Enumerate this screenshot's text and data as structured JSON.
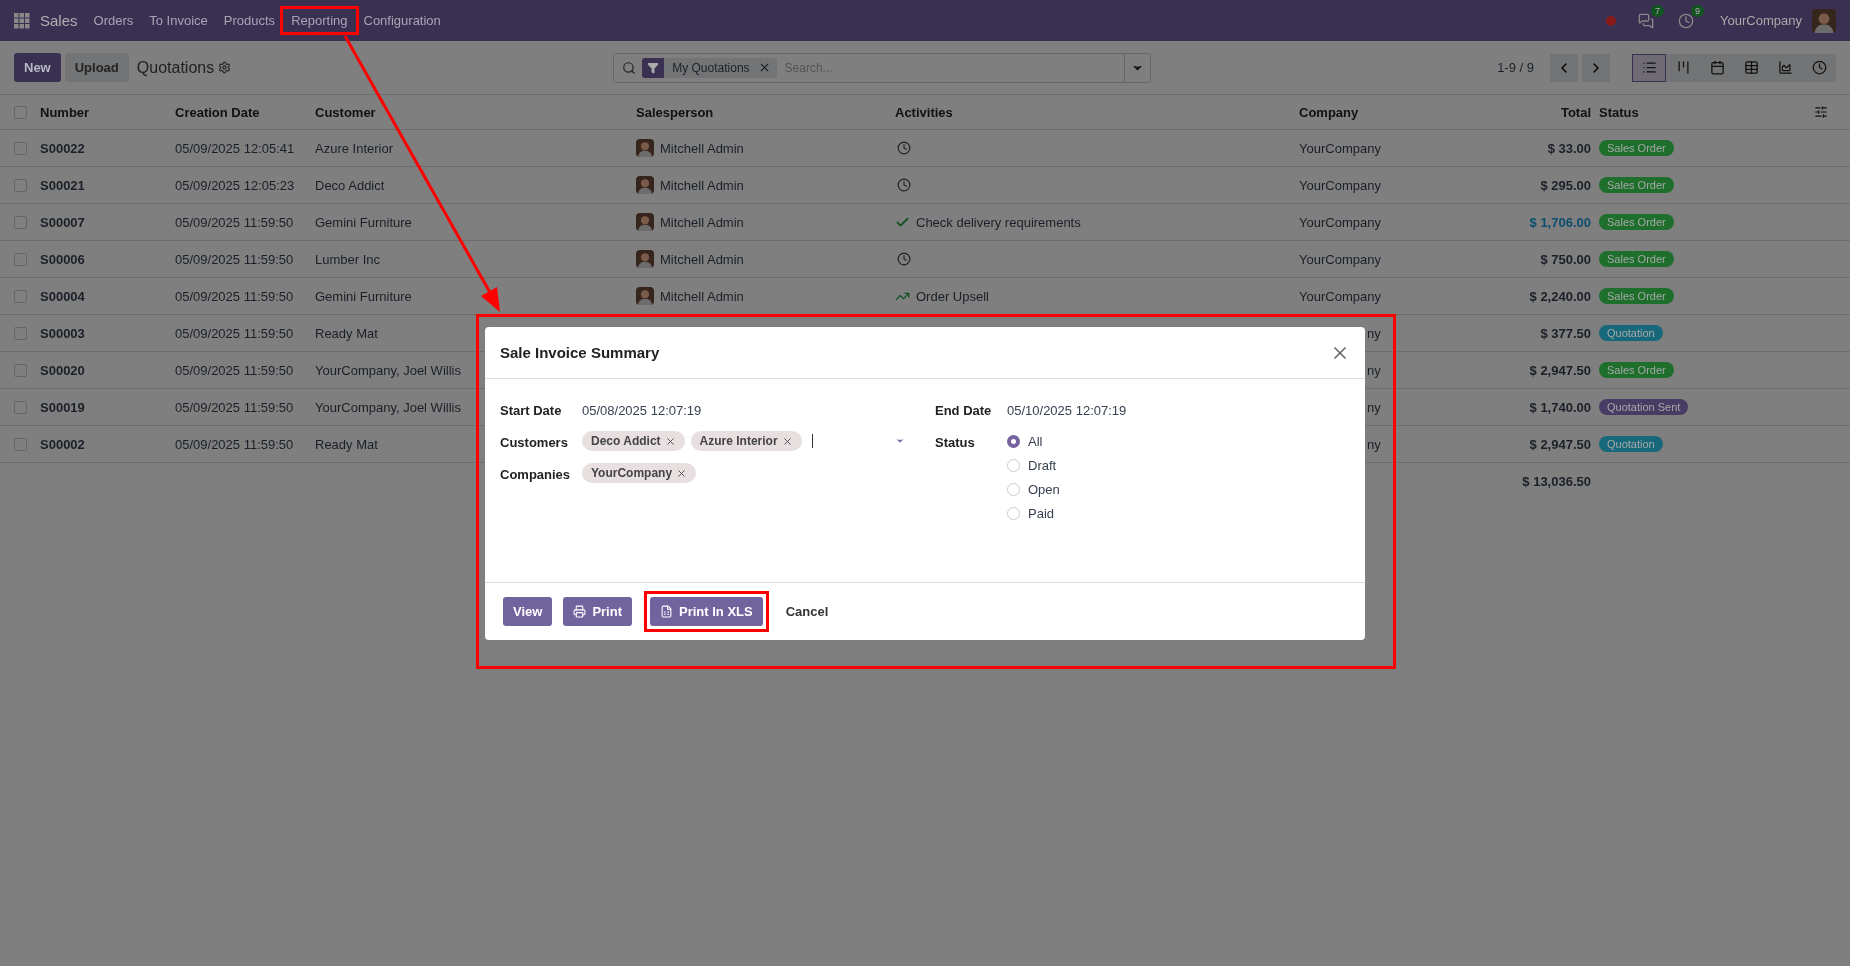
{
  "topbar": {
    "app": "Sales",
    "menu": [
      {
        "label": "Orders",
        "annotated": false
      },
      {
        "label": "To Invoice",
        "annotated": false
      },
      {
        "label": "Products",
        "annotated": false
      },
      {
        "label": "Reporting",
        "annotated": true
      },
      {
        "label": "Configuration",
        "annotated": false
      }
    ],
    "messages_badge": "7",
    "activities_badge": "9",
    "company": "YourCompany"
  },
  "control_panel": {
    "new_button": "New",
    "upload_button": "Upload",
    "title": "Quotations",
    "search": {
      "facet": "My Quotations",
      "placeholder": "Search..."
    },
    "pager": "1-9 / 9",
    "views": [
      {
        "kind": "list",
        "selected": true
      },
      {
        "kind": "kanban",
        "selected": false
      },
      {
        "kind": "calendar",
        "selected": false
      },
      {
        "kind": "pivot",
        "selected": false
      },
      {
        "kind": "graph",
        "selected": false
      },
      {
        "kind": "activity",
        "selected": false
      }
    ]
  },
  "table": {
    "select_all_checked": false,
    "columns": [
      "Number",
      "Creation Date",
      "Customer",
      "Salesperson",
      "Activities",
      "Company",
      "Total",
      "Status"
    ],
    "rows": [
      {
        "checked": false,
        "number": "S00022",
        "date": "05/09/2025 12:05:41",
        "customer": "Azure Interior",
        "salesperson": "Mitchell Admin",
        "activity": {
          "kind": "clock"
        },
        "company": "YourCompany",
        "company_clipped": false,
        "total": "$ 33.00",
        "total_emphasized": false,
        "status": "Sales Order",
        "color": "#1e6e2c"
      },
      {
        "checked": false,
        "number": "S00021",
        "date": "05/09/2025 12:05:23",
        "customer": "Deco Addict",
        "salesperson": "Mitchell Admin",
        "activity": {
          "kind": "clock"
        },
        "company": "YourCompany",
        "company_clipped": false,
        "total": "$ 295.00",
        "total_emphasized": false,
        "status": "Sales Order",
        "color": "#1e6e2c"
      },
      {
        "checked": false,
        "number": "S00007",
        "date": "05/09/2025 11:59:50",
        "customer": "Gemini Furniture",
        "salesperson": "Mitchell Admin",
        "activity": {
          "kind": "done",
          "text": "Check delivery requirements"
        },
        "company": "YourCompany",
        "company_clipped": false,
        "total": "$ 1,706.00",
        "total_emphasized": true,
        "status": "Sales Order",
        "color": "#1e6e2c"
      },
      {
        "checked": false,
        "number": "S00006",
        "date": "05/09/2025 11:59:50",
        "customer": "Lumber Inc",
        "salesperson": "Mitchell Admin",
        "activity": {
          "kind": "clock"
        },
        "company": "YourCompany",
        "company_clipped": false,
        "total": "$ 750.00",
        "total_emphasized": false,
        "status": "Sales Order",
        "color": "#1e6e2c"
      },
      {
        "checked": false,
        "number": "S00004",
        "date": "05/09/2025 11:59:50",
        "customer": "Gemini Furniture",
        "salesperson": "Mitchell Admin",
        "activity": {
          "kind": "upsell",
          "text": "Order Upsell"
        },
        "company": "YourCompany",
        "company_clipped": false,
        "total": "$ 2,240.00",
        "total_emphasized": false,
        "status": "Sales Order",
        "color": "#1e6e2c"
      },
      {
        "checked": false,
        "number": "S00003",
        "date": "05/09/2025 11:59:50",
        "customer": "Ready Mat",
        "company": "ny",
        "company_clipped": true,
        "total": "$ 377.50",
        "total_emphasized": false,
        "status": "Quotation",
        "color": "#17687a"
      },
      {
        "checked": false,
        "number": "S00020",
        "date": "05/09/2025 11:59:50",
        "customer": "YourCompany, Joel Willis",
        "company": "ny",
        "company_clipped": true,
        "total": "$ 2,947.50",
        "total_emphasized": false,
        "status": "Sales Order",
        "color": "#1e6e2c"
      },
      {
        "checked": false,
        "number": "S00019",
        "date": "05/09/2025 11:59:50",
        "customer": "YourCompany, Joel Willis",
        "company": "ny",
        "company_clipped": true,
        "total": "$ 1,740.00",
        "total_emphasized": false,
        "status": "Quotation Sent",
        "color": "#473c63"
      },
      {
        "checked": false,
        "number": "S00002",
        "date": "05/09/2025 11:59:50",
        "customer": "Ready Mat",
        "company": "ny",
        "company_clipped": true,
        "total": "$ 2,947.50",
        "total_emphasized": false,
        "status": "Quotation",
        "color": "#17687a"
      }
    ],
    "grand_total": "$ 13,036.50"
  },
  "dialog": {
    "title": "Sale Invoice Summary",
    "start_date": {
      "label": "Start Date",
      "value": "05/08/2025 12:07:19"
    },
    "end_date": {
      "label": "End Date",
      "value": "05/10/2025 12:07:19"
    },
    "customers": {
      "label": "Customers",
      "tags": [
        "Deco Addict",
        "Azure Interior"
      ]
    },
    "companies": {
      "label": "Companies",
      "tags": [
        "YourCompany"
      ]
    },
    "status": {
      "label": "Status",
      "options": [
        {
          "label": "All",
          "selected": true
        },
        {
          "label": "Draft",
          "selected": false
        },
        {
          "label": "Open",
          "selected": false
        },
        {
          "label": "Paid",
          "selected": false
        }
      ]
    },
    "buttons": [
      {
        "kind": "view",
        "label": "View",
        "annotated": false
      },
      {
        "kind": "print",
        "label": "Print",
        "annotated": false
      },
      {
        "kind": "xls",
        "label": "Print In XLS",
        "annotated": true
      },
      {
        "kind": "cancel",
        "label": "Cancel",
        "annotated": false
      }
    ]
  }
}
